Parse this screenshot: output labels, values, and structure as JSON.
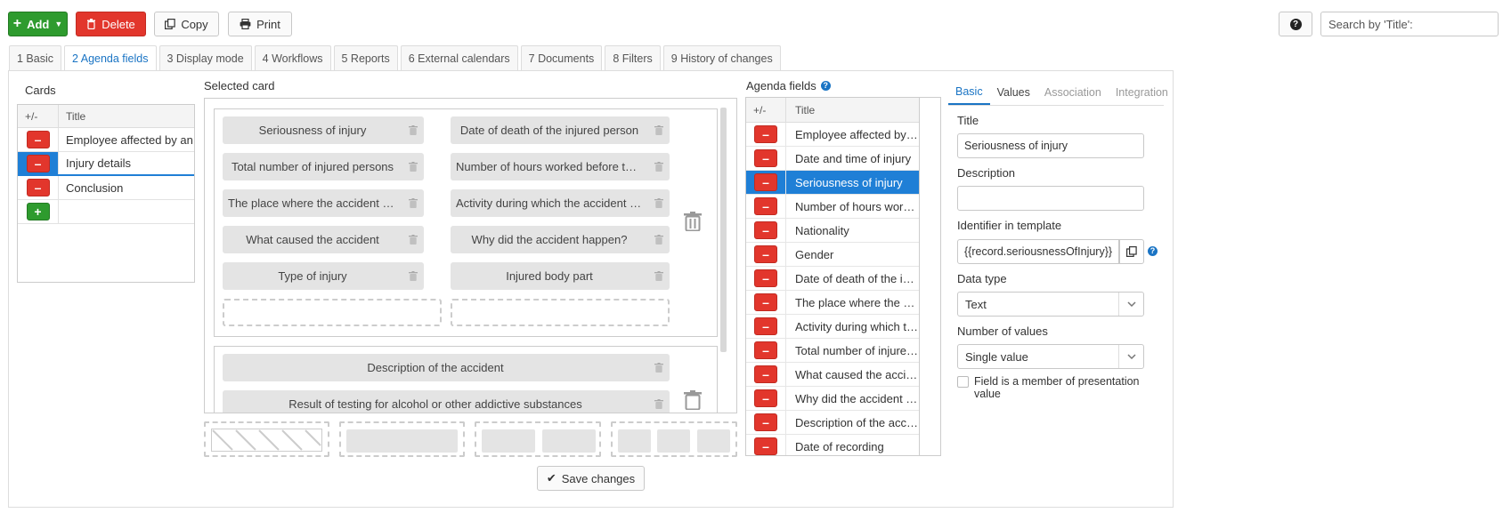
{
  "toolbar": {
    "add_label": "Add",
    "delete_label": "Delete",
    "copy_label": "Copy",
    "print_label": "Print",
    "help_label": "?",
    "search_placeholder": "Search by 'Title':"
  },
  "tabs": [
    {
      "label": "1 Basic"
    },
    {
      "label": "2 Agenda fields",
      "active": true
    },
    {
      "label": "3 Display mode"
    },
    {
      "label": "4 Workflows"
    },
    {
      "label": "5 Reports"
    },
    {
      "label": "6 External calendars"
    },
    {
      "label": "7 Documents"
    },
    {
      "label": "8 Filters"
    },
    {
      "label": "9 History of changes"
    }
  ],
  "cards": {
    "title": "Cards",
    "col_pm": "+/-",
    "col_title": "Title",
    "rows": [
      {
        "title": "Employee affected by an"
      },
      {
        "title": "Injury details",
        "selected": true
      },
      {
        "title": "Conclusion"
      }
    ]
  },
  "selected_card": {
    "title": "Selected card",
    "group1": [
      "Seriousness of injury",
      "Date of death of the injured person",
      "Total number of injured persons",
      "Number of hours worked before the accident",
      "The place where the accident occurred",
      "Activity during which the accident occurred",
      "What caused the accident",
      "Why did the accident happen?",
      "Type of injury",
      "Injured body part"
    ],
    "group2": [
      "Description of the accident",
      "Result of testing for alcohol or other addictive substances"
    ]
  },
  "agenda_fields": {
    "title": "Agenda fields",
    "col_pm": "+/-",
    "col_title": "Title",
    "rows": [
      {
        "title": "Employee affected by the accident"
      },
      {
        "title": "Date and time of injury"
      },
      {
        "title": "Seriousness of injury",
        "selected": true
      },
      {
        "title": "Number of hours worked before the accident"
      },
      {
        "title": "Nationality"
      },
      {
        "title": "Gender"
      },
      {
        "title": "Date of death of the injured person"
      },
      {
        "title": "The place where the accident occurred"
      },
      {
        "title": "Activity during which the accident occurred"
      },
      {
        "title": "Total number of injured persons"
      },
      {
        "title": "What caused the accident"
      },
      {
        "title": "Why did the accident happen?"
      },
      {
        "title": "Description of the accident"
      },
      {
        "title": "Date of recording"
      }
    ]
  },
  "properties": {
    "tabs": [
      "Basic",
      "Values",
      "Association",
      "Integration"
    ],
    "title_label": "Title",
    "title_value": "Seriousness of injury",
    "description_label": "Description",
    "description_value": "",
    "identifier_label": "Identifier in template",
    "identifier_value": "{{record.seriousnessOfInjury}}",
    "datatype_label": "Data type",
    "datatype_value": "Text",
    "numvalues_label": "Number of values",
    "numvalues_value": "Single value",
    "presentation_label": "Field is a member of presentation value"
  },
  "save_label": "Save changes",
  "colors": {
    "accent": "#1f7fd6",
    "danger": "#e2362c",
    "success": "#2e9b2e"
  }
}
